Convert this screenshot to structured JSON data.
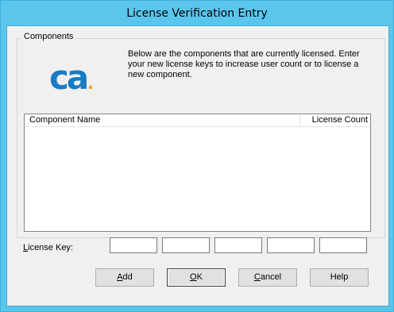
{
  "window": {
    "title": "License Verification Entry"
  },
  "group": {
    "label": "Components"
  },
  "logo": {
    "text": "ca",
    "color": "#1a7cc4",
    "accent": "#f0a000"
  },
  "description": "Below are the components that are currently licensed. Enter your new license keys to increase user count or to license a new component.",
  "table": {
    "columns": [
      "Component Name",
      "License Count"
    ],
    "rows": []
  },
  "license_key": {
    "label_accel": "L",
    "label_rest": "icense Key:",
    "segments": [
      "",
      "",
      "",
      "",
      ""
    ]
  },
  "buttons": {
    "add": {
      "accel": "A",
      "rest": "dd"
    },
    "ok": {
      "accel": "O",
      "rest": "K"
    },
    "cancel": {
      "accel": "C",
      "rest": "ancel"
    },
    "help": {
      "label": "Help"
    }
  }
}
